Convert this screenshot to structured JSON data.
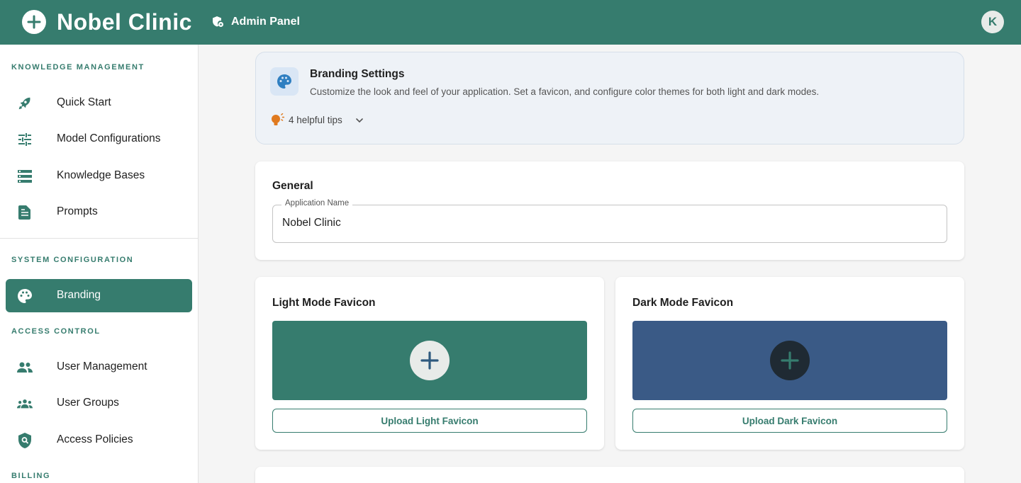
{
  "header": {
    "app_title": "Nobel Clinic",
    "admin_label": "Admin Panel",
    "avatar_initial": "K",
    "brand_color": "#367c6e"
  },
  "sidebar": {
    "sections": [
      {
        "label": "KNOWLEDGE MANAGEMENT"
      },
      {
        "label": "SYSTEM CONFIGURATION"
      },
      {
        "label": "ACCESS CONTROL"
      },
      {
        "label": "BILLING"
      }
    ],
    "items": [
      {
        "label": "Quick Start",
        "icon": "rocket-icon"
      },
      {
        "label": "Model Configurations",
        "icon": "tune-sliders-icon"
      },
      {
        "label": "Knowledge Bases",
        "icon": "storage-icon"
      },
      {
        "label": "Prompts",
        "icon": "document-icon"
      },
      {
        "label": "Branding",
        "icon": "palette-icon",
        "active": true
      },
      {
        "label": "User Management",
        "icon": "people-icon"
      },
      {
        "label": "User Groups",
        "icon": "groups-icon"
      },
      {
        "label": "Access Policies",
        "icon": "shield-search-icon"
      }
    ]
  },
  "tips": {
    "title": "Branding Settings",
    "description": "Customize the look and feel of your application. Set a favicon, and configure color themes for both light and dark modes.",
    "count_label": "4 helpful tips"
  },
  "general": {
    "title": "General",
    "app_name_label": "Application Name",
    "app_name_value": "Nobel Clinic"
  },
  "favicons": {
    "light": {
      "title": "Light Mode Favicon",
      "button": "Upload Light Favicon",
      "bg_color": "#367c6e"
    },
    "dark": {
      "title": "Dark Mode Favicon",
      "button": "Upload Dark Favicon",
      "bg_color": "#3a5a86"
    }
  }
}
